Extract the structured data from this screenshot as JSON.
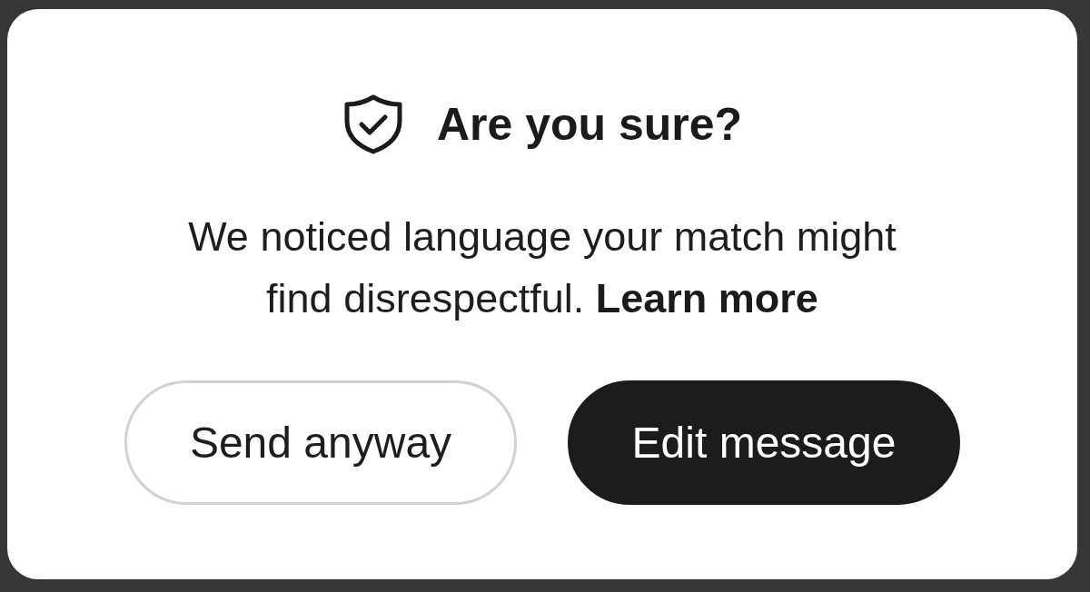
{
  "dialog": {
    "title": "Are you sure?",
    "message": "We noticed language your match might find disrespectful.",
    "link": "Learn more",
    "buttons": [
      {
        "label": "Send anyway",
        "kind": "secondary"
      },
      {
        "label": "Edit message",
        "kind": "primary"
      }
    ]
  }
}
